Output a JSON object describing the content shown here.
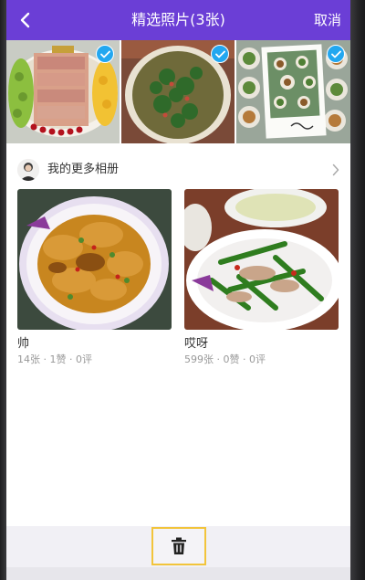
{
  "header": {
    "title": "精选照片(3张)",
    "cancel_label": "取消",
    "background": "#6b3ed6"
  },
  "selected_photos": [
    {
      "subject": "money cake",
      "selected": true
    },
    {
      "subject": "vegetable dish",
      "selected": true
    },
    {
      "subject": "dishes collage",
      "selected": true
    }
  ],
  "albums_section": {
    "title": "我的更多相册",
    "albums": [
      {
        "name": "帅",
        "meta": "14张 · 1赞 · 0评"
      },
      {
        "name": "哎呀",
        "meta": "599张 · 0赞 · 0评"
      }
    ]
  },
  "toolbar": {
    "delete_icon": "trash-icon",
    "highlight_color": "#f2c43b"
  },
  "colors": {
    "check_badge": "#22a7f0"
  }
}
